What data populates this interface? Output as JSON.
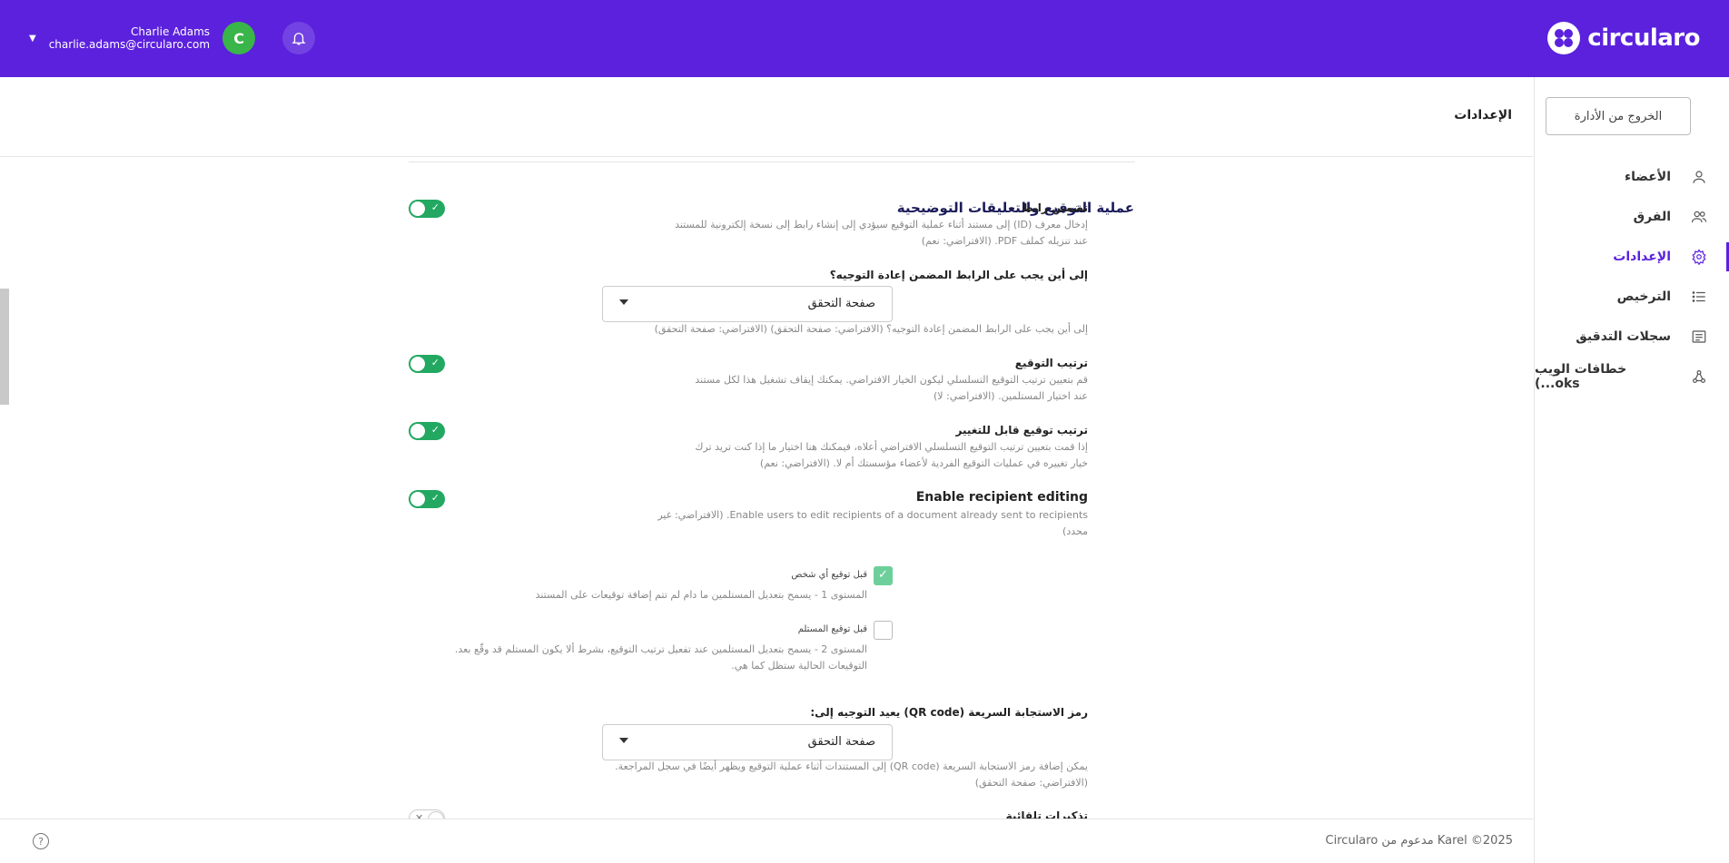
{
  "header": {
    "brand": "circularo",
    "user_name": "Charlie Adams",
    "user_email": "charlie.adams@circularo.com",
    "avatar_letter": "C",
    "brand_color": "#5b21dd"
  },
  "sidebar": {
    "exit_label": "الخروج من الأدارة",
    "items": [
      {
        "label": "الأعضاء",
        "icon": "user-icon"
      },
      {
        "label": "الفرق",
        "icon": "users-icon"
      },
      {
        "label": "الإعدادات",
        "icon": "gear-icon",
        "active": true
      },
      {
        "label": "الترخيص",
        "icon": "list-icon"
      },
      {
        "label": "سجلات التدقيق",
        "icon": "log-icon"
      },
      {
        "label": "خطافات الويب (...oks",
        "icon": "webhook-icon"
      }
    ]
  },
  "main": {
    "page_title": "الإعدادات",
    "section_title": "عملية التوقيع والتعليقات التوضيحية",
    "fields": {
      "embed_link": {
        "label": "تضمين رابط",
        "desc1": "إدخال معرف (ID) إلى مستند أثناء عملية التوقيع سيؤدي إلى إنشاء رابط إلى نسخة إلكترونية للمستند",
        "desc2": "عند تنزيله كملف PDF. (الافتراضي: نعم)"
      },
      "redirect": {
        "label": "إلى أين يجب على الرابط المضمن إعادة التوجيه؟",
        "value": "صفحة التحقق",
        "desc": "إلى أين يجب على الرابط المضمن إعادة التوجيه؟ (الافتراضي: صفحة التحقق) (الافتراضي: صفحة التحقق)"
      },
      "sign_order": {
        "label": "ترتيب التوقيع",
        "desc1": "قم بتعيين ترتيب التوقيع التسلسلي ليكون الخيار الافتراضي. يمكنك إيقاف تشغيل هذا لكل مستند",
        "desc2": "عند اختيار المستلمين. (الافتراضي: لا)"
      },
      "changeable_order": {
        "label": "ترتيب توقيع قابل للتغيير",
        "desc1": "إذا قمت بتعيين ترتيب التوقيع التسلسلي الافتراضي أعلاه، فيمكنك هنا اختيار ما إذا كنت تريد ترك",
        "desc2": "خيار تغييره في عمليات التوقيع الفردية لأعضاء مؤسستك أم لا. (الافتراضي: نعم)"
      },
      "recipient_editing": {
        "label": "Enable recipient editing",
        "desc1": "Enable users to edit recipients of a document already sent to recipients. (الافتراضي: غير",
        "desc2": "محدد)"
      },
      "level1": {
        "label": "قبل توقيع أي شخص",
        "desc": "المستوى 1 - يسمح بتعديل المستلمين ما دام لم تتم إضافة توقيعات على المستند"
      },
      "level2": {
        "label": "قبل توقيع المستلم",
        "desc1": "المستوى 2 - يسمح بتعديل المستلمين عند تفعيل ترتيب التوقيع، بشرط ألا يكون المستلم قد وقّع بعد.",
        "desc2": "التوقيعات الحالية ستظل كما هي."
      },
      "qr_redirect": {
        "label": "رمز الاستجابة السريعة (QR code) يعيد التوجيه إلى:",
        "value": "صفحة التحقق",
        "desc1": "يمكن إضافة رمز الاستجابة السريعة (QR code) إلى المستندات أثناء عملية التوقيع ويظهر أيضًا في سجل المراجعة.",
        "desc2": "(الافتراضي: صفحة التحقق)"
      },
      "reminders": {
        "label": "تذكيرات تلقائية"
      }
    }
  },
  "footer": {
    "copyright": "Circularo مدعوم من Karel ©2025"
  }
}
